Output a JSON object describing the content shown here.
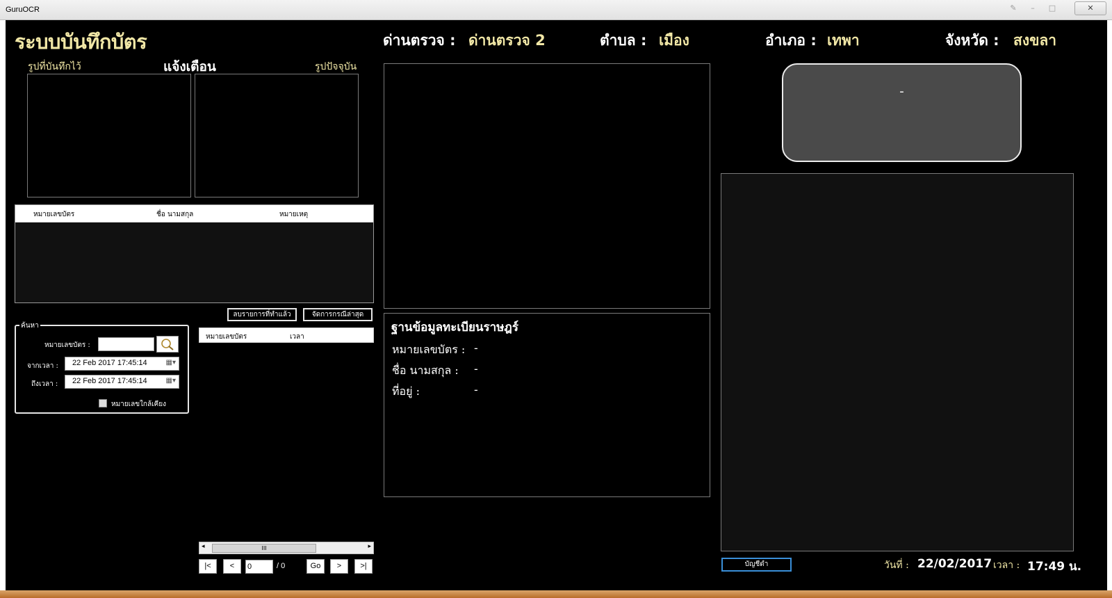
{
  "window": {
    "app_title": "GuruOCR",
    "close_glyph": "✕"
  },
  "header": {
    "system_title": "ระบบบันทึกบัตร",
    "checkpoint_label": "ด่านตรวจ :",
    "checkpoint_value": "ด่านตรวจ 2",
    "subdistrict_label": "ตำบล :",
    "subdistrict_value": "เมือง",
    "district_label": "อำเภอ :",
    "district_value": "เทพา",
    "province_label": "จังหวัด :",
    "province_value": "สงขลา"
  },
  "photos": {
    "saved_label": "รูปที่บันทึกไว้",
    "alert_label": "แจ้งเตือน",
    "current_label": "รูปปัจจุบัน"
  },
  "alert_grid": {
    "columns": [
      "หมายเลขบัตร",
      "ชื่อ นามสกุล",
      "หมายเหตุ"
    ]
  },
  "actions": {
    "clear_done": "ลบรายการที่ทำแล้ว",
    "handle_latest": "จัดการกรณีล่าสุด"
  },
  "search": {
    "group_title": "ค้นหา",
    "card_no_label": "หมายเลขบัตร :",
    "card_no_value": "",
    "from_label": "จากเวลา :",
    "from_value": "22 Feb 2017   17:45:14",
    "to_label": "ถึงเวลา :",
    "to_value": "22 Feb 2017   17:45:14",
    "similar_label": "หมายเลขใกล้เคียง",
    "similar_checked": false
  },
  "results_grid": {
    "columns": [
      "หมายเลขบัตร",
      "เวลา"
    ],
    "scroll_thumb": "III"
  },
  "pager": {
    "first": "|<",
    "prev": "<",
    "page_value": "0",
    "total": "/ 0",
    "go": "Go",
    "next": ">",
    "last": ">|"
  },
  "registry": {
    "title": "ฐานข้อมูลทะเบียนราษฎร์",
    "card_label": "หมายเลขบัตร :",
    "card_value": "-",
    "name_label": "ชื่อ นามสกุล :",
    "name_value": "-",
    "address_label": "ที่อยู่ :",
    "address_value": "-"
  },
  "result_panel": {
    "value": "-"
  },
  "footer": {
    "blacklist_button": "บัญชีดำ",
    "date_label": "วันที่ :",
    "date_value": "22/02/2017",
    "time_label": "เวลา :",
    "time_value": "17:49 น."
  },
  "colors": {
    "gold": "#f1e7a6",
    "background": "#000000",
    "panel_gray": "#4a4a4a",
    "accent_blue": "#3a8fd8"
  }
}
